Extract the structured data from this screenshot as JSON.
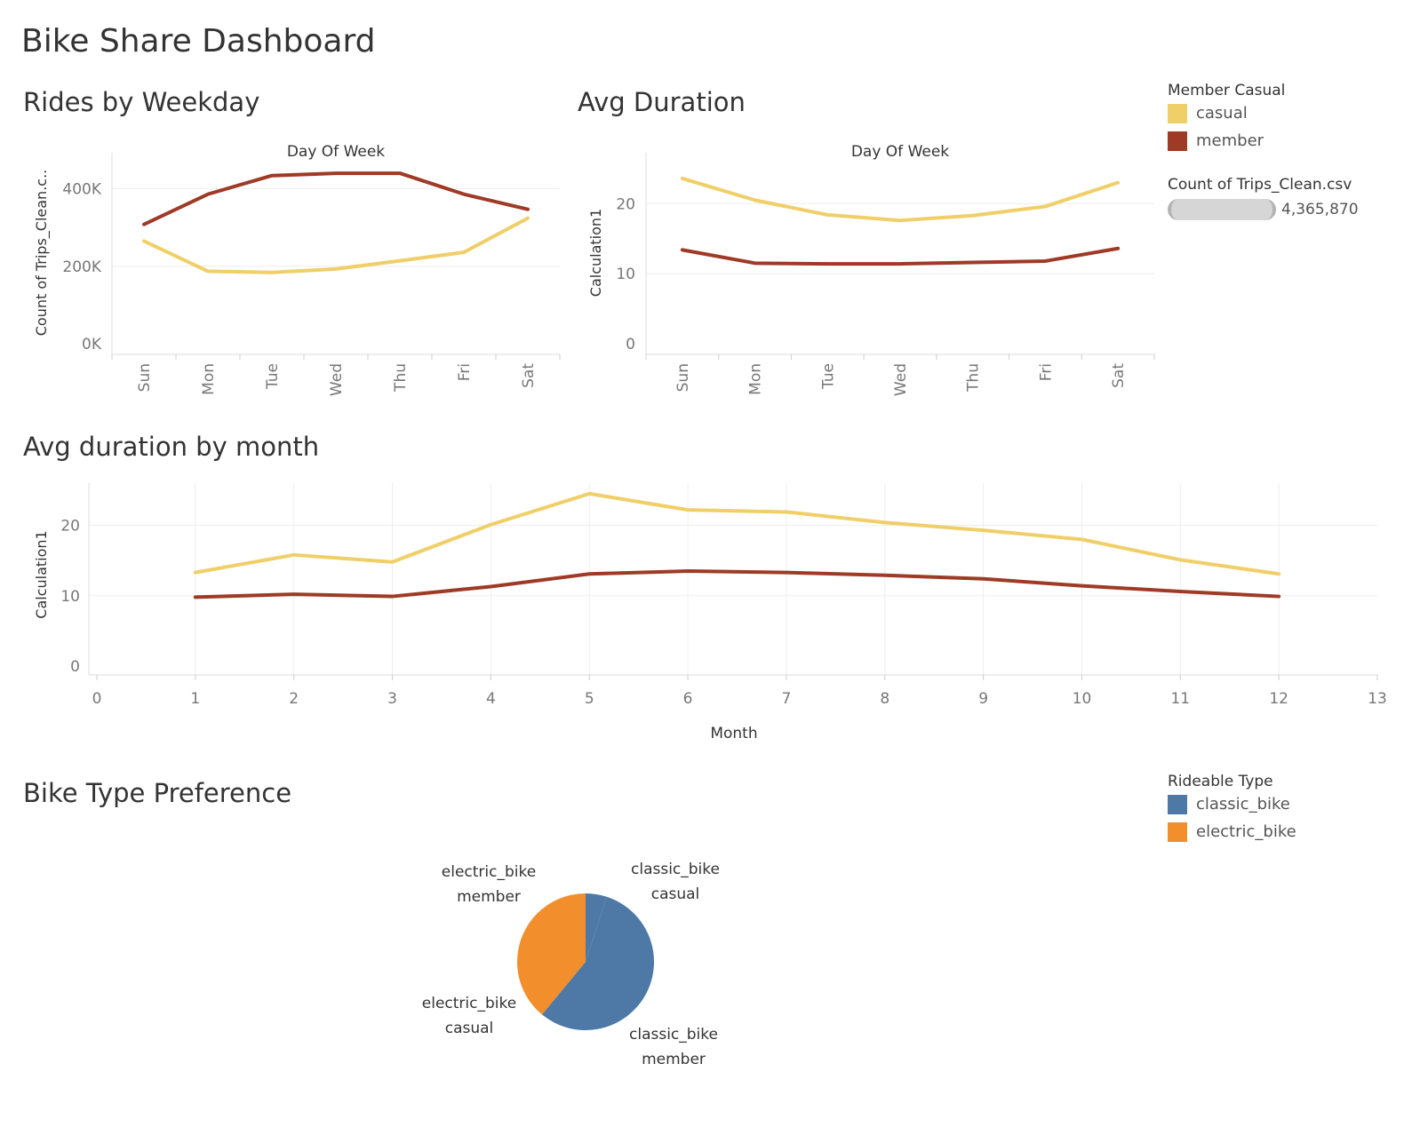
{
  "page_title": "Bike Share Dashboard",
  "sheets": {
    "rides_title": "Rides by Weekday",
    "avg_title": "Avg Duration",
    "month_title": "Avg duration by month",
    "pie_title": "Bike Type Preference"
  },
  "legend_member": {
    "title": "Member Casual",
    "items": [
      {
        "label": "casual",
        "color": "#f0cf68"
      },
      {
        "label": "member",
        "color": "#9e3a26"
      }
    ]
  },
  "legend_size": {
    "title": "Count of Trips_Clean.csv",
    "value": "4,365,870"
  },
  "legend_ride": {
    "title": "Rideable Type",
    "items": [
      {
        "label": "classic_bike",
        "color": "#4e79a7"
      },
      {
        "label": "electric_bike",
        "color": "#f28e2b"
      }
    ]
  },
  "chart_data": [
    {
      "type": "line",
      "title": "Rides by Weekday",
      "top_axis_label": "Day Of Week",
      "ylabel": "Count of Trips_Clean.c..",
      "categories": [
        "Sun",
        "Mon",
        "Tue",
        "Wed",
        "Thu",
        "Fri",
        "Sat"
      ],
      "ylim": [
        0,
        470000
      ],
      "yticks": [
        0,
        200000,
        400000
      ],
      "ytick_labels": [
        "0K",
        "200K",
        "400K"
      ],
      "series": [
        {
          "name": "casual",
          "color": "#f0cf68",
          "values": [
            265000,
            187000,
            184000,
            193000,
            214000,
            236000,
            324000
          ]
        },
        {
          "name": "member",
          "color": "#9e3a26",
          "values": [
            308000,
            386000,
            434000,
            440000,
            440000,
            386000,
            347000
          ]
        }
      ],
      "grid": true,
      "legend": "right"
    },
    {
      "type": "line",
      "title": "Avg Duration",
      "top_axis_label": "Day Of Week",
      "ylabel": "Calculation1",
      "categories": [
        "Sun",
        "Mon",
        "Tue",
        "Wed",
        "Thu",
        "Fri",
        "Sat"
      ],
      "ylim": [
        0,
        26
      ],
      "yticks": [
        0,
        10,
        20
      ],
      "ytick_labels": [
        "0",
        "10",
        "20"
      ],
      "series": [
        {
          "name": "casual",
          "color": "#f0cf68",
          "values": [
            23.6,
            20.5,
            18.4,
            17.6,
            18.3,
            19.6,
            23.0
          ]
        },
        {
          "name": "member",
          "color": "#9e3a26",
          "values": [
            13.4,
            11.5,
            11.4,
            11.4,
            11.6,
            11.8,
            13.6
          ]
        }
      ],
      "grid": true,
      "legend": "right"
    },
    {
      "type": "line",
      "title": "Avg duration by month",
      "xlabel": "Month",
      "ylabel": "Calculation1",
      "x": [
        1,
        2,
        3,
        4,
        5,
        6,
        7,
        8,
        9,
        10,
        11,
        12
      ],
      "xlim": [
        0,
        13
      ],
      "xticks": [
        0,
        1,
        2,
        3,
        4,
        5,
        6,
        7,
        8,
        9,
        10,
        11,
        12,
        13
      ],
      "ylim": [
        0,
        26
      ],
      "yticks": [
        0,
        10,
        20
      ],
      "ytick_labels": [
        "0",
        "10",
        "20"
      ],
      "series": [
        {
          "name": "casual",
          "color": "#f0cf68",
          "values": [
            13.3,
            15.8,
            14.8,
            20.1,
            24.5,
            22.2,
            21.9,
            20.4,
            19.3,
            18.0,
            15.1,
            13.1
          ]
        },
        {
          "name": "member",
          "color": "#9e3a26",
          "values": [
            9.8,
            10.2,
            9.9,
            11.3,
            13.1,
            13.5,
            13.3,
            12.9,
            12.4,
            11.4,
            10.6,
            9.9
          ]
        }
      ],
      "grid": true,
      "legend": "right"
    },
    {
      "type": "pie",
      "title": "Bike Type Preference",
      "slices": [
        {
          "type": "classic_bike",
          "group": "casual",
          "value": 0.05,
          "color": "#4e79a7"
        },
        {
          "type": "classic_bike",
          "group": "member",
          "value": 0.56,
          "color": "#4e79a7"
        },
        {
          "type": "electric_bike",
          "group": "casual",
          "value": 0.14,
          "color": "#f28e2b"
        },
        {
          "type": "electric_bike",
          "group": "member",
          "value": 0.25,
          "color": "#f28e2b"
        }
      ],
      "labels": [
        {
          "line1": "classic_bike",
          "line2": "casual"
        },
        {
          "line1": "classic_bike",
          "line2": "member"
        },
        {
          "line1": "electric_bike",
          "line2": "casual"
        },
        {
          "line1": "electric_bike",
          "line2": "member"
        }
      ],
      "legend": "right"
    }
  ]
}
